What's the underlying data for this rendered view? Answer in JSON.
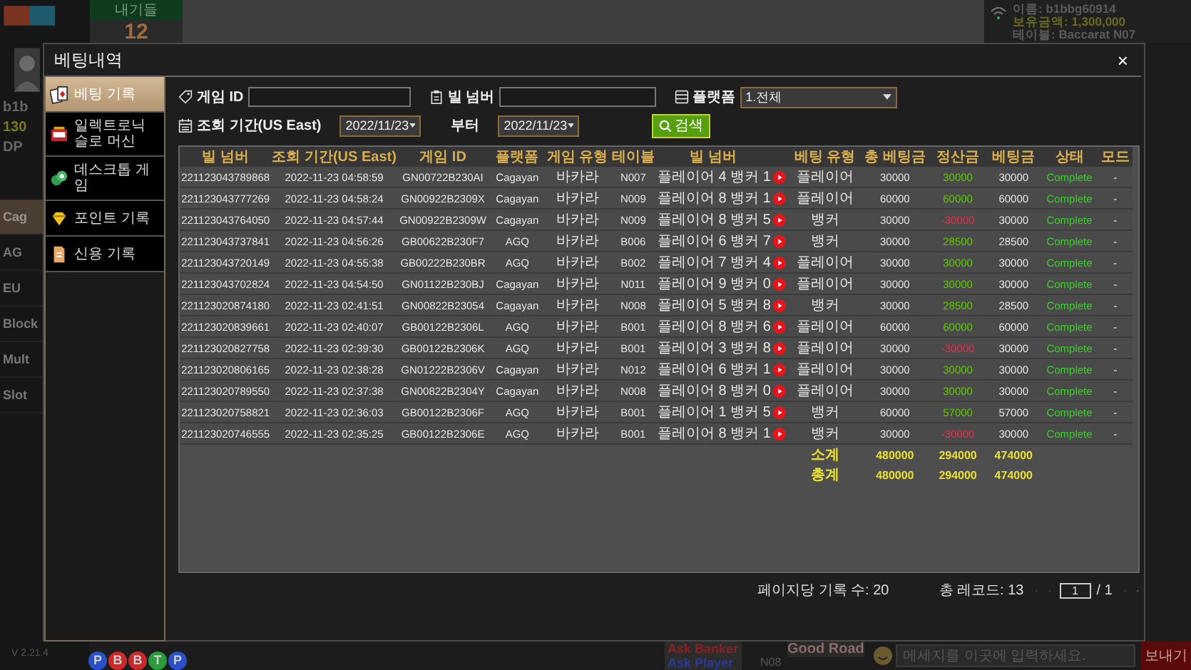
{
  "background": {
    "bets_label": "내기들",
    "bets_count": "12",
    "player_info": [
      "이름: b1bbg60914",
      "보유금액: 1,300,000",
      "테이블: Baccarat N07"
    ],
    "user_lines": [
      "b1b",
      "130",
      "DP"
    ],
    "lobby_items": [
      {
        "label": "Cag",
        "selected": true
      },
      {
        "label": "AG",
        "selected": false
      },
      {
        "label": "EU",
        "selected": false
      },
      {
        "label": "Block",
        "selected": false
      },
      {
        "label": "Mult",
        "selected": false
      },
      {
        "label": "Slot",
        "selected": false
      }
    ],
    "version": "V 2.21.4",
    "beads": [
      {
        "text": "P",
        "color": "#2a50c8"
      },
      {
        "text": "B",
        "color": "#c82a2a"
      },
      {
        "text": "B",
        "color": "#c82a2a"
      },
      {
        "text": "T",
        "color": "#2a9a3a"
      },
      {
        "text": "P",
        "color": "#2a50c8"
      }
    ],
    "ask_banker": "Ask Banker",
    "ask_player": "Ask Player",
    "road_table": "N08",
    "good_road": "Good Road",
    "chat_placeholder": "메세지를 이곳에 입력하세요.",
    "send": "보내기"
  },
  "dialog": {
    "title": "베팅내역",
    "close": "×"
  },
  "sidebar": {
    "items": [
      {
        "label": "베팅 기록",
        "selected": true
      },
      {
        "label": "일렉트로닉 슬로 머신",
        "selected": false
      },
      {
        "label": "데스크톱 게임",
        "selected": false
      },
      {
        "label": "포인트 기록",
        "selected": false
      },
      {
        "label": "신용 기록",
        "selected": false
      }
    ]
  },
  "filters": {
    "game_id_label": "게임 ID",
    "bill_label": "빌 넘버",
    "platform_label": "플랫폼",
    "platform_value": "1.전체",
    "period_label": "조회 기간(US East)",
    "date_from": "2022/11/23",
    "from_label": "부터",
    "date_to": "2022/11/23",
    "search": "검색"
  },
  "table": {
    "columns": [
      "빌 넘버",
      "조회 기간(US East)",
      "게임 ID",
      "플랫폼",
      "게임 유형",
      "테이블",
      "빌 넘버",
      "베팅 유형",
      "총 베팅금",
      "정산금",
      "베팅금",
      "상태",
      "모드"
    ],
    "rows": [
      {
        "bill": "221123043789868",
        "time": "2022-11-23 04:58:59",
        "game_id": "GN00722B230AI",
        "platform": "Cagayan",
        "game_type": "바카라",
        "table": "N007",
        "result": "플레이어 4 뱅커 1",
        "bet_type": "플레이어",
        "total_bet": "30000",
        "settlement": {
          "text": "30000",
          "color": "#5ec800"
        },
        "bet": "30000",
        "status": "Complete",
        "mode": "-"
      },
      {
        "bill": "221123043777269",
        "time": "2022-11-23 04:58:24",
        "game_id": "GN00922B2309X",
        "platform": "Cagayan",
        "game_type": "바카라",
        "table": "N009",
        "result": "플레이어 8 뱅커 1",
        "bet_type": "플레이어",
        "total_bet": "60000",
        "settlement": {
          "text": "60000",
          "color": "#5ec800"
        },
        "bet": "60000",
        "status": "Complete",
        "mode": "-"
      },
      {
        "bill": "221123043764050",
        "time": "2022-11-23 04:57:44",
        "game_id": "GN00922B2309W",
        "platform": "Cagayan",
        "game_type": "바카라",
        "table": "N009",
        "result": "플레이어 8 뱅커 5",
        "bet_type": "뱅커",
        "total_bet": "30000",
        "settlement": {
          "text": "-30000",
          "color": "#e8304c"
        },
        "bet": "30000",
        "status": "Complete",
        "mode": "-"
      },
      {
        "bill": "221123043737841",
        "time": "2022-11-23 04:56:26",
        "game_id": "GB00622B230F7",
        "platform": "AGQ",
        "game_type": "바카라",
        "table": "B006",
        "result": "플레이어 6 뱅커 7",
        "bet_type": "뱅커",
        "total_bet": "30000",
        "settlement": {
          "text": "28500",
          "color": "#5ec800"
        },
        "bet": "28500",
        "status": "Complete",
        "mode": "-"
      },
      {
        "bill": "221123043720149",
        "time": "2022-11-23 04:55:38",
        "game_id": "GB00222B230BR",
        "platform": "AGQ",
        "game_type": "바카라",
        "table": "B002",
        "result": "플레이어 7 뱅커 4",
        "bet_type": "플레이어",
        "total_bet": "30000",
        "settlement": {
          "text": "30000",
          "color": "#5ec800"
        },
        "bet": "30000",
        "status": "Complete",
        "mode": "-"
      },
      {
        "bill": "221123043702824",
        "time": "2022-11-23 04:54:50",
        "game_id": "GN01122B230BJ",
        "platform": "Cagayan",
        "game_type": "바카라",
        "table": "N011",
        "result": "플레이어 9 뱅커 0",
        "bet_type": "플레이어",
        "total_bet": "30000",
        "settlement": {
          "text": "30000",
          "color": "#5ec800"
        },
        "bet": "30000",
        "status": "Complete",
        "mode": "-"
      },
      {
        "bill": "221123020874180",
        "time": "2022-11-23 02:41:51",
        "game_id": "GN00822B23054",
        "platform": "Cagayan",
        "game_type": "바카라",
        "table": "N008",
        "result": "플레이어 5 뱅커 8",
        "bet_type": "뱅커",
        "total_bet": "30000",
        "settlement": {
          "text": "28500",
          "color": "#5ec800"
        },
        "bet": "28500",
        "status": "Complete",
        "mode": "-"
      },
      {
        "bill": "221123020839661",
        "time": "2022-11-23 02:40:07",
        "game_id": "GB00122B2306L",
        "platform": "AGQ",
        "game_type": "바카라",
        "table": "B001",
        "result": "플레이어 8 뱅커 6",
        "bet_type": "플레이어",
        "total_bet": "60000",
        "settlement": {
          "text": "60000",
          "color": "#5ec800"
        },
        "bet": "60000",
        "status": "Complete",
        "mode": "-"
      },
      {
        "bill": "221123020827758",
        "time": "2022-11-23 02:39:30",
        "game_id": "GB00122B2306K",
        "platform": "AGQ",
        "game_type": "바카라",
        "table": "B001",
        "result": "플레이어 3 뱅커 8",
        "bet_type": "플레이어",
        "total_bet": "30000",
        "settlement": {
          "text": "-30000",
          "color": "#e8304c"
        },
        "bet": "30000",
        "status": "Complete",
        "mode": "-"
      },
      {
        "bill": "221123020806165",
        "time": "2022-11-23 02:38:28",
        "game_id": "GN01222B2306V",
        "platform": "Cagayan",
        "game_type": "바카라",
        "table": "N012",
        "result": "플레이어 6 뱅커 1",
        "bet_type": "플레이어",
        "total_bet": "30000",
        "settlement": {
          "text": "30000",
          "color": "#5ec800"
        },
        "bet": "30000",
        "status": "Complete",
        "mode": "-"
      },
      {
        "bill": "221123020789550",
        "time": "2022-11-23 02:37:38",
        "game_id": "GN00822B2304Y",
        "platform": "Cagayan",
        "game_type": "바카라",
        "table": "N008",
        "result": "플레이어 8 뱅커 0",
        "bet_type": "플레이어",
        "total_bet": "30000",
        "settlement": {
          "text": "30000",
          "color": "#5ec800"
        },
        "bet": "30000",
        "status": "Complete",
        "mode": "-"
      },
      {
        "bill": "221123020758821",
        "time": "2022-11-23 02:36:03",
        "game_id": "GB00122B2306F",
        "platform": "AGQ",
        "game_type": "바카라",
        "table": "B001",
        "result": "플레이어 1 뱅커 5",
        "bet_type": "뱅커",
        "total_bet": "60000",
        "settlement": {
          "text": "57000",
          "color": "#5ec800"
        },
        "bet": "57000",
        "status": "Complete",
        "mode": "-"
      },
      {
        "bill": "221123020746555",
        "time": "2022-11-23 02:35:25",
        "game_id": "GB00122B2306E",
        "platform": "AGQ",
        "game_type": "바카라",
        "table": "B001",
        "result": "플레이어 8 뱅커 1",
        "bet_type": "뱅커",
        "total_bet": "30000",
        "settlement": {
          "text": "-30000",
          "color": "#e8304c"
        },
        "bet": "30000",
        "status": "Complete",
        "mode": "-"
      }
    ],
    "summary": [
      {
        "label": "소계",
        "total_bet": "480000",
        "settlement": "294000",
        "bet": "474000"
      },
      {
        "label": "총계",
        "total_bet": "480000",
        "settlement": "294000",
        "bet": "474000"
      }
    ]
  },
  "footer": {
    "per_page": "페이지당 기록 수: 20",
    "total": "총 레코드: 13",
    "page": "1",
    "pages": "/ 1"
  }
}
